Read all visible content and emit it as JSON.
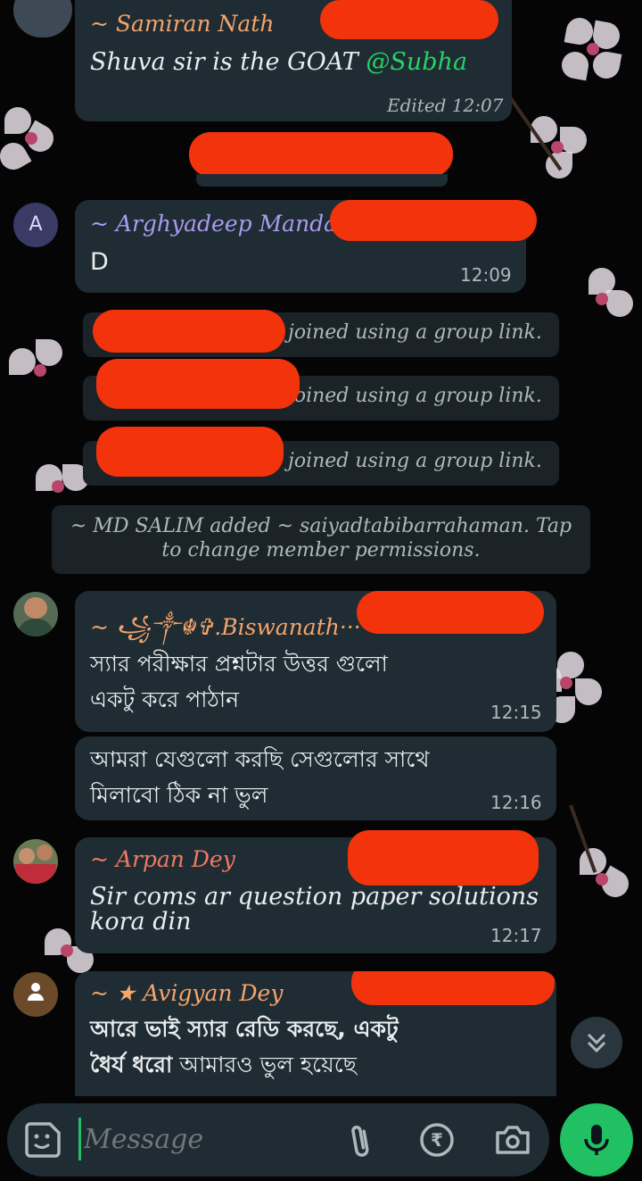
{
  "messages": [
    {
      "sender": "~ Samiran  Nath",
      "sender_color": "#f5a46a",
      "text": "Shuva  sir  is  the  GOAT",
      "mention": "@Subha",
      "time": "Edited 12:07"
    },
    {
      "avatar_letter": "A",
      "sender": "~ Arghyadeep  Mandal",
      "sender_color": "#a99cf0",
      "text": "D",
      "time": "12:09"
    },
    {
      "sender": "~ ꧁༒☬✞.Biswanath···",
      "sender_color": "#f5a46a",
      "text_line1": "স্যার  পরীক্ষার  প্রশ্নটার  উত্তর  গুলো",
      "text_line2": "একটু  করে  পাঠান",
      "time": "12:15"
    },
    {
      "text_line1": "আমরা  যেগুলো  করছি  সেগুলোর  সাথে",
      "text_line2": "মিলাবো  ঠিক  না  ভুল",
      "time": "12:16"
    },
    {
      "sender": "~ Arpan  Dey",
      "sender_color": "#f07a62",
      "text_line1": "Sir  coms  ar  question  paper  solutions",
      "text_line2": "kora  din",
      "time": "12:17"
    },
    {
      "sender": "~ ★  Avigyan  Dey",
      "sender_color": "#f5a46a",
      "text_line1": "আরে ভাই স্যার রেডি করছে, একটু",
      "text_line2_bold": "ধৈর্য ধরো",
      "text_line2_rest": " আমারও ভুল হয়েছে"
    }
  ],
  "system": {
    "joined_1": "joined  using  a  group  link.",
    "joined_2": "joined  using  a  group  link.",
    "joined_3": "joined  using  a  group  link.",
    "added_line1": "~ MD  SALIM  added  ~ saiyadtabibarrahaman.  Tap",
    "added_line2": "to  change  member  permissions."
  },
  "composer": {
    "placeholder": "Message"
  },
  "icons": {
    "emoji": "sticker-icon",
    "attach": "paperclip-icon",
    "payment": "rupee-icon",
    "camera": "camera-icon",
    "mic": "mic-icon",
    "scroll": "chevron-double-down-icon"
  },
  "colors": {
    "bubble": "#1f2c33",
    "accent_green": "#21c063",
    "mention": "#25d366"
  }
}
